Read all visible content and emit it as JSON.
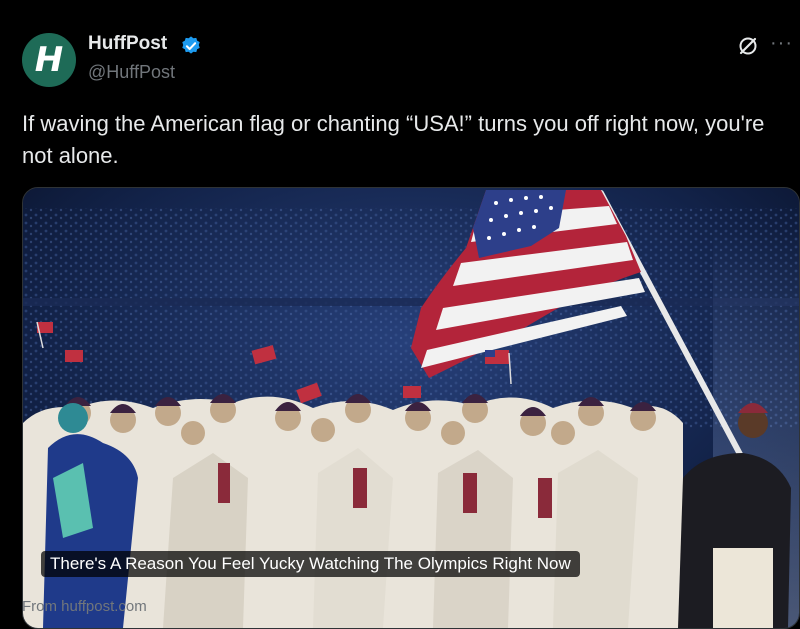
{
  "tweet": {
    "author_name": "HuffPost",
    "handle": "@HuffPost",
    "avatar_letter": "H",
    "text": "If waving the American flag or chanting “USA!” turns you off right now, you're not alone."
  },
  "card": {
    "caption": "There's A Reason You Feel Yucky Watching The Olympics Right Now",
    "source": "From huffpost.com",
    "image_alt": "Team USA athletes in white coats marching with a large American flag at the Olympic opening ceremony"
  },
  "colors": {
    "background": "#000000",
    "avatar_bg": "#1e6b57",
    "verified_badge": "#1d9bf0",
    "muted_text": "#71767b",
    "primary_text": "#e7e9ea"
  },
  "icons": {
    "verified": "verified-badge-icon",
    "grok": "grok-icon",
    "more": "more-icon"
  }
}
